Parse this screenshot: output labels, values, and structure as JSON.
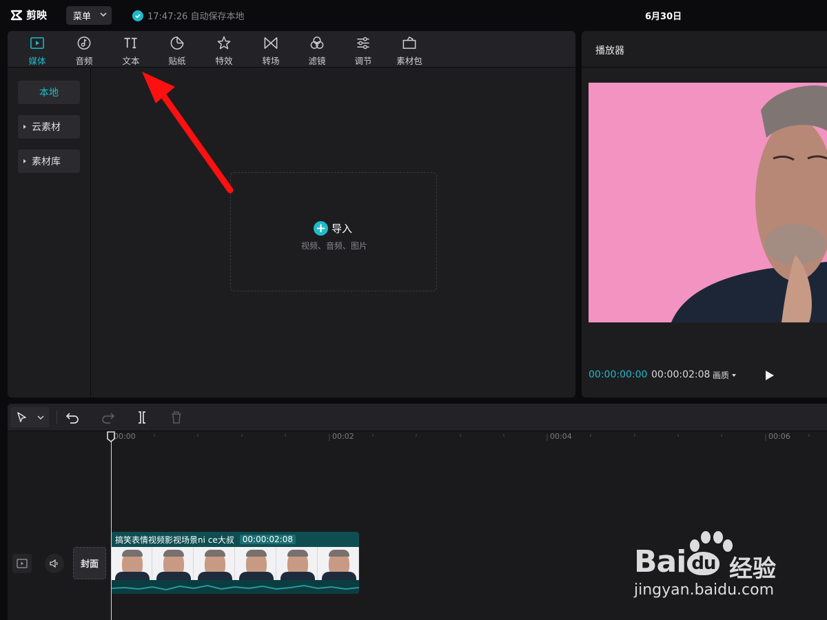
{
  "app": {
    "name": "剪映",
    "menu_label": "菜单",
    "autosave_text": "17:47:26 自动保存本地",
    "date": "6月30日"
  },
  "media_toolbar": {
    "tabs": [
      {
        "label": "媒体",
        "icon": "media-icon",
        "active": true
      },
      {
        "label": "音频",
        "icon": "audio-icon"
      },
      {
        "label": "文本",
        "icon": "text-icon"
      },
      {
        "label": "贴纸",
        "icon": "sticker-icon"
      },
      {
        "label": "特效",
        "icon": "effects-icon"
      },
      {
        "label": "转场",
        "icon": "transition-icon"
      },
      {
        "label": "滤镜",
        "icon": "filter-icon"
      },
      {
        "label": "调节",
        "icon": "adjust-icon"
      },
      {
        "label": "素材包",
        "icon": "asset-pack-icon"
      }
    ]
  },
  "media_sidebar": {
    "items": [
      {
        "label": "本地",
        "active": true
      },
      {
        "label": "云素材"
      },
      {
        "label": "素材库"
      }
    ]
  },
  "import": {
    "label": "导入",
    "hint": "视频、音频、图片"
  },
  "player": {
    "title": "播放器",
    "current_time": "00:00:00:00",
    "total_time": "00:00:02:08",
    "quality_label": "画质"
  },
  "timeline": {
    "ruler": [
      "00:00",
      "00:02",
      "00:04",
      "00:06"
    ],
    "cover_label": "封面",
    "clip": {
      "title": "搞笑表情视频影视场景ni ce大叔",
      "duration": "00:00:02:08"
    }
  },
  "watermark": {
    "brand": "Bai",
    "brand_badge": "du",
    "brand_cn": "经验",
    "url": "jingyan.baidu.com"
  },
  "colors": {
    "accent": "#1fbbcb",
    "background": "#0b0b0d",
    "panel": "#1d1d20",
    "video_bg": "#f393c2",
    "clip": "#0e4e51",
    "arrow": "#ff1010"
  }
}
